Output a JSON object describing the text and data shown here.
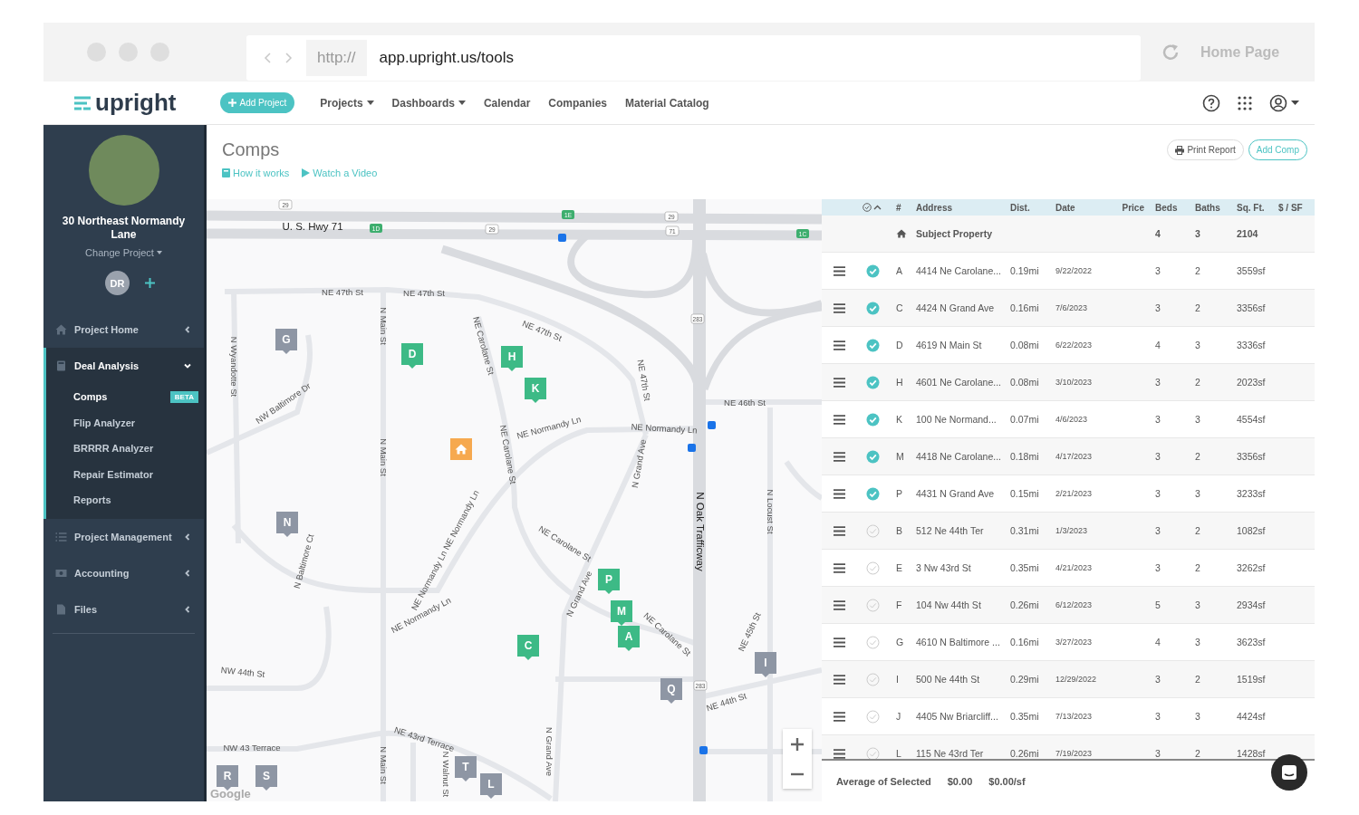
{
  "browser": {
    "protocol": "http://",
    "url": "app.upright.us/tools",
    "home": "Home Page"
  },
  "topnav": {
    "logo": "upright",
    "add_button": "Add Project",
    "items": [
      {
        "label": "Projects",
        "dropdown": true
      },
      {
        "label": "Dashboards",
        "dropdown": true
      },
      {
        "label": "Calendar",
        "dropdown": false
      },
      {
        "label": "Companies",
        "dropdown": false
      },
      {
        "label": "Material Catalog",
        "dropdown": false
      }
    ]
  },
  "sidebar": {
    "project_name": "30 Northeast Normandy Lane",
    "change_project": "Change Project",
    "avatar": "DR",
    "items": [
      {
        "label": "Project Home",
        "expanded": false
      },
      {
        "label": "Deal Analysis",
        "expanded": true,
        "children": [
          {
            "label": "Comps",
            "selected": true,
            "badge": "BETA"
          },
          {
            "label": "Flip Analyzer",
            "selected": false
          },
          {
            "label": "BRRRR Analyzer",
            "selected": false
          },
          {
            "label": "Repair Estimator",
            "selected": false
          },
          {
            "label": "Reports",
            "selected": false
          }
        ]
      },
      {
        "label": "Project Management",
        "expanded": false
      },
      {
        "label": "Accounting",
        "expanded": false
      },
      {
        "label": "Files",
        "expanded": false
      }
    ]
  },
  "page": {
    "title": "Comps",
    "links": [
      "How it works",
      "Watch a Video"
    ],
    "print_button": "Print Report",
    "add_button": "Add Comp"
  },
  "map": {
    "streets": [
      "U. S. Hwy 71",
      "NE 47th St",
      "NE 47th St",
      "NE 47th St",
      "N Wyandotte St",
      "N Main St",
      "NE Carolane St",
      "NE 47th St",
      "NE 46th St",
      "NW Baltimore Dr",
      "NE Normandy Ln",
      "NE Normandy Ln",
      "N Grand Ave",
      "N Main St",
      "NE Carolane St",
      "N Oak Trafficway",
      "N Locust St",
      "N Baltimore Ct",
      "NE Normandy Ln NE Normandy Ln",
      "NE Normandy Ln",
      "NE Carolane St",
      "N Grand Ave",
      "NE Carolane St",
      "NE 45th St",
      "NW 44th St",
      "NE 44th St",
      "NE 43rd Terrace",
      "NW 43 Terrace",
      "N Main St",
      "N Walnut St",
      "N Grand Ave"
    ],
    "shields": [
      "29",
      "1E",
      "1D",
      "29",
      "29",
      "71",
      "1C",
      "283",
      "283"
    ],
    "markers": [
      {
        "letter": "G",
        "selected": false
      },
      {
        "letter": "D",
        "selected": true
      },
      {
        "letter": "H",
        "selected": true
      },
      {
        "letter": "K",
        "selected": true
      },
      {
        "letter": "N",
        "selected": false
      },
      {
        "letter": "P",
        "selected": true
      },
      {
        "letter": "M",
        "selected": true
      },
      {
        "letter": "A",
        "selected": true
      },
      {
        "letter": "C",
        "selected": true
      },
      {
        "letter": "Q",
        "selected": false
      },
      {
        "letter": "I",
        "selected": false
      },
      {
        "letter": "T",
        "selected": false
      },
      {
        "letter": "L",
        "selected": false
      },
      {
        "letter": "R",
        "selected": false
      },
      {
        "letter": "S",
        "selected": false
      }
    ],
    "attribution": "Google"
  },
  "table": {
    "columns": [
      "#",
      "Address",
      "Dist.",
      "Date",
      "Price",
      "Beds",
      "Baths",
      "Sq. Ft.",
      "$ / SF"
    ],
    "subject": {
      "address": "Subject Property",
      "beds": "4",
      "baths": "3",
      "sqft": "2104"
    },
    "rows": [
      {
        "letter": "A",
        "address": "4414 Ne Carolane...",
        "dist": "0.19mi",
        "date": "9/22/2022",
        "beds": "3",
        "baths": "2",
        "sqft": "3559sf",
        "checked": true
      },
      {
        "letter": "C",
        "address": "4424 N Grand Ave",
        "dist": "0.16mi",
        "date": "7/6/2023",
        "beds": "3",
        "baths": "2",
        "sqft": "3356sf",
        "checked": true
      },
      {
        "letter": "D",
        "address": "4619 N Main St",
        "dist": "0.08mi",
        "date": "6/22/2023",
        "beds": "4",
        "baths": "3",
        "sqft": "3336sf",
        "checked": true
      },
      {
        "letter": "H",
        "address": "4601 Ne Carolane...",
        "dist": "0.08mi",
        "date": "3/10/2023",
        "beds": "3",
        "baths": "2",
        "sqft": "2023sf",
        "checked": true
      },
      {
        "letter": "K",
        "address": "100 Ne Normand...",
        "dist": "0.07mi",
        "date": "4/6/2023",
        "beds": "3",
        "baths": "3",
        "sqft": "4554sf",
        "checked": true
      },
      {
        "letter": "M",
        "address": "4418 Ne Carolane...",
        "dist": "0.18mi",
        "date": "4/17/2023",
        "beds": "3",
        "baths": "2",
        "sqft": "3356sf",
        "checked": true
      },
      {
        "letter": "P",
        "address": "4431 N Grand Ave",
        "dist": "0.15mi",
        "date": "2/21/2023",
        "beds": "3",
        "baths": "3",
        "sqft": "3233sf",
        "checked": true
      },
      {
        "letter": "B",
        "address": "512 Ne 44th Ter",
        "dist": "0.31mi",
        "date": "1/3/2023",
        "beds": "3",
        "baths": "2",
        "sqft": "1082sf",
        "checked": false
      },
      {
        "letter": "E",
        "address": "3 Nw 43rd St",
        "dist": "0.35mi",
        "date": "4/21/2023",
        "beds": "3",
        "baths": "2",
        "sqft": "3262sf",
        "checked": false
      },
      {
        "letter": "F",
        "address": "104 Nw 44th St",
        "dist": "0.26mi",
        "date": "6/12/2023",
        "beds": "5",
        "baths": "3",
        "sqft": "2934sf",
        "checked": false
      },
      {
        "letter": "G",
        "address": "4610 N Baltimore ...",
        "dist": "0.16mi",
        "date": "3/27/2023",
        "beds": "4",
        "baths": "3",
        "sqft": "3623sf",
        "checked": false
      },
      {
        "letter": "I",
        "address": "500 Ne 44th St",
        "dist": "0.29mi",
        "date": "12/29/2022",
        "beds": "3",
        "baths": "2",
        "sqft": "1519sf",
        "checked": false
      },
      {
        "letter": "J",
        "address": "4405 Nw Briarcliff...",
        "dist": "0.35mi",
        "date": "7/13/2023",
        "beds": "3",
        "baths": "3",
        "sqft": "4424sf",
        "checked": false
      },
      {
        "letter": "L",
        "address": "115 Ne 43rd Ter",
        "dist": "0.26mi",
        "date": "7/19/2023",
        "beds": "3",
        "baths": "2",
        "sqft": "1428sf",
        "checked": false
      }
    ],
    "footer": {
      "label": "Average of Selected",
      "price": "$0.00",
      "per_sf": "$0.00/sf"
    }
  }
}
